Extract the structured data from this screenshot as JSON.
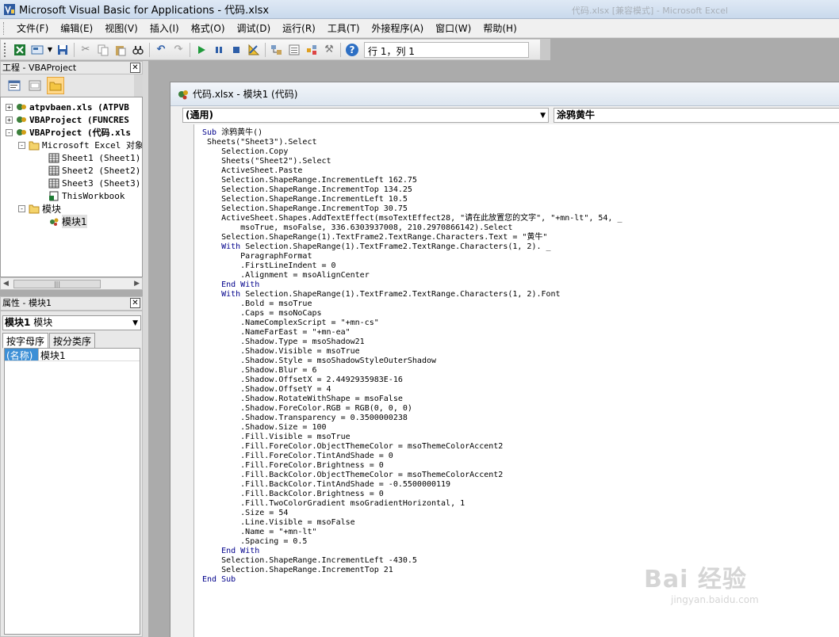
{
  "window": {
    "title": "Microsoft Visual Basic for Applications - 代码.xlsx",
    "ghost_title": "代码.xlsx [兼容模式] - Microsoft Excel"
  },
  "menu": [
    "文件(F)",
    "编辑(E)",
    "视图(V)",
    "插入(I)",
    "格式(O)",
    "调试(D)",
    "运行(R)",
    "工具(T)",
    "外接程序(A)",
    "窗口(W)",
    "帮助(H)"
  ],
  "toolbar": {
    "status": "行 1，列 1"
  },
  "project": {
    "title": "工程 - VBAProject",
    "tree": [
      {
        "label": "atpvbaen.xls (ATPVB",
        "bold": true,
        "expander": "+"
      },
      {
        "label": "VBAProject (FUNCRES",
        "bold": true,
        "expander": "+"
      },
      {
        "label": "VBAProject (代码.xls",
        "bold": true,
        "expander": "-"
      },
      {
        "label": "Microsoft Excel 对象",
        "bold": false,
        "expander": "-"
      },
      {
        "label": "Sheet1 (Sheet1)",
        "bold": false,
        "expander": ""
      },
      {
        "label": "Sheet2 (Sheet2)",
        "bold": false,
        "expander": ""
      },
      {
        "label": "Sheet3 (Sheet3)",
        "bold": false,
        "expander": ""
      },
      {
        "label": "ThisWorkbook",
        "bold": false,
        "expander": ""
      },
      {
        "label": "模块",
        "bold": false,
        "expander": "-"
      },
      {
        "label": "模块1",
        "bold": false,
        "expander": ""
      }
    ]
  },
  "properties": {
    "title": "属性 - 模块1",
    "object_name": "模块1",
    "object_type": "模块",
    "tabs": [
      "按字母序",
      "按分类序"
    ],
    "rows": [
      {
        "key": "(名称)",
        "value": "模块1"
      }
    ]
  },
  "code_window": {
    "title": "代码.xlsx - 模块1 (代码)",
    "object_dropdown": "(通用)",
    "proc_dropdown": "涂鸦黄牛",
    "lines": [
      "Sub 涂鸦黄牛()",
      " Sheets(\"Sheet3\").Select",
      "    Selection.Copy",
      "    Sheets(\"Sheet2\").Select",
      "    ActiveSheet.Paste",
      "    Selection.ShapeRange.IncrementLeft 162.75",
      "    Selection.ShapeRange.IncrementTop 134.25",
      "    Selection.ShapeRange.IncrementLeft 10.5",
      "    Selection.ShapeRange.IncrementTop 30.75",
      "    ActiveSheet.Shapes.AddTextEffect(msoTextEffect28, \"请在此放置您的文字\", \"+mn-lt\", 54, _",
      "        msoTrue, msoFalse, 336.6303937008, 210.2970866142).Select",
      "    Selection.ShapeRange(1).TextFrame2.TextRange.Characters.Text = \"黄牛\"",
      "    With Selection.ShapeRange(1).TextFrame2.TextRange.Characters(1, 2). _",
      "        ParagraphFormat",
      "        .FirstLineIndent = 0",
      "        .Alignment = msoAlignCenter",
      "    End With",
      "    With Selection.ShapeRange(1).TextFrame2.TextRange.Characters(1, 2).Font",
      "        .Bold = msoTrue",
      "        .Caps = msoNoCaps",
      "        .NameComplexScript = \"+mn-cs\"",
      "        .NameFarEast = \"+mn-ea\"",
      "        .Shadow.Type = msoShadow21",
      "        .Shadow.Visible = msoTrue",
      "        .Shadow.Style = msoShadowStyleOuterShadow",
      "        .Shadow.Blur = 6",
      "        .Shadow.OffsetX = 2.4492935983E-16",
      "        .Shadow.OffsetY = 4",
      "        .Shadow.RotateWithShape = msoFalse",
      "        .Shadow.ForeColor.RGB = RGB(0, 0, 0)",
      "        .Shadow.Transparency = 0.3500000238",
      "        .Shadow.Size = 100",
      "        .Fill.Visible = msoTrue",
      "        .Fill.ForeColor.ObjectThemeColor = msoThemeColorAccent2",
      "        .Fill.ForeColor.TintAndShade = 0",
      "        .Fill.ForeColor.Brightness = 0",
      "        .Fill.BackColor.ObjectThemeColor = msoThemeColorAccent2",
      "        .Fill.BackColor.TintAndShade = -0.5500000119",
      "        .Fill.BackColor.Brightness = 0",
      "        .Fill.TwoColorGradient msoGradientHorizontal, 1",
      "        .Size = 54",
      "        .Line.Visible = msoFalse",
      "        .Name = \"+mn-lt\"",
      "        .Spacing = 0.5",
      "    End With",
      "    Selection.ShapeRange.IncrementLeft -430.5",
      "    Selection.ShapeRange.IncrementTop 21",
      "End Sub"
    ]
  },
  "watermark": {
    "main": "Bai 经验",
    "sub": "jingyan.baidu.com"
  },
  "colors": {
    "keyword": "#00008b",
    "selection_blue": "#3c8fd6"
  }
}
